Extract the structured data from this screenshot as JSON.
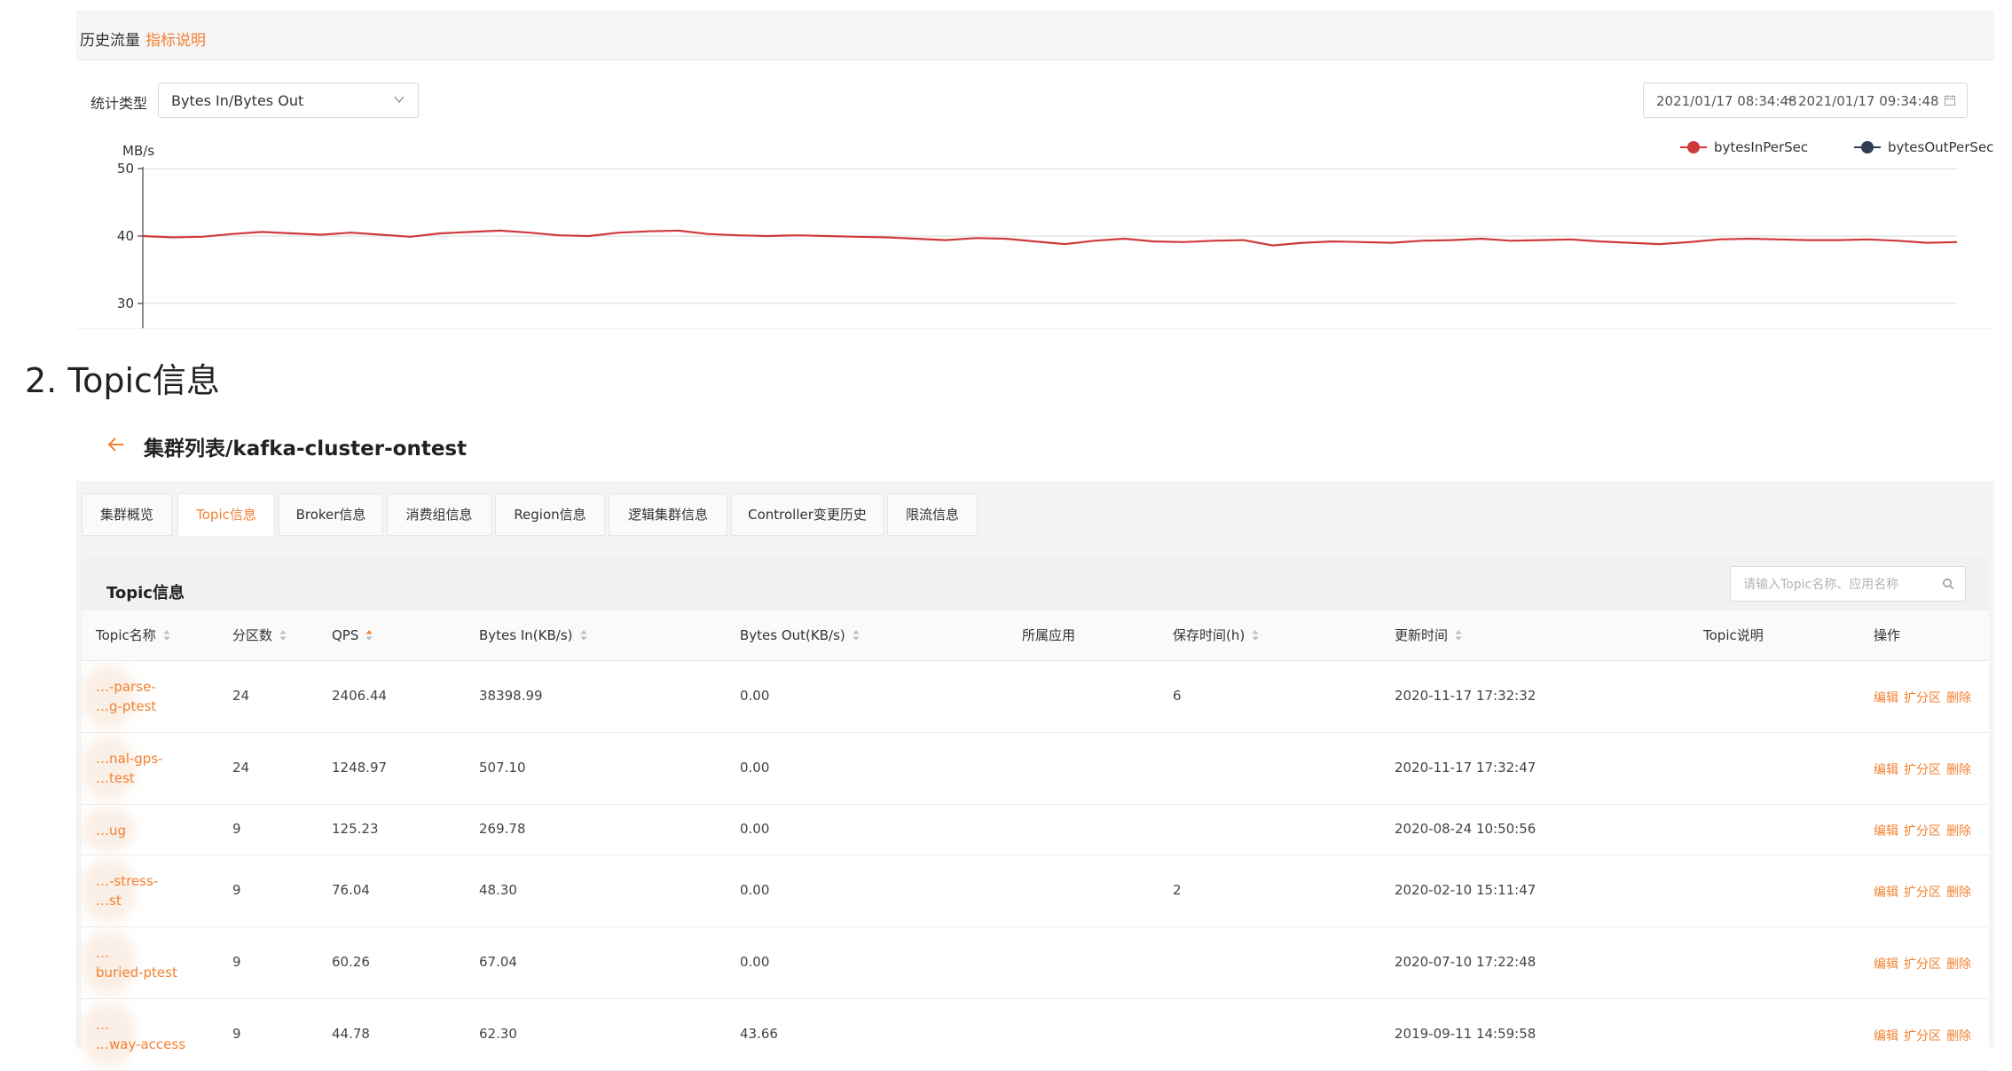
{
  "history": {
    "title": "历史流量",
    "link": "指标说明",
    "stat_label": "统计类型",
    "stat_select_value": "Bytes In/Bytes Out",
    "date_start": "2021/01/17 08:34:48",
    "date_sep": "~",
    "date_end": "2021/01/17 09:34:48"
  },
  "chart_data": {
    "type": "line",
    "ylabel": "MB/s",
    "yticks": [
      50,
      40,
      30
    ],
    "ylim": [
      28,
      52
    ],
    "grid": true,
    "legend_position": "top-right",
    "series": [
      {
        "name": "bytesInPerSec",
        "color": "#d03a3a",
        "values": [
          40.0,
          39.8,
          39.9,
          40.3,
          40.6,
          40.4,
          40.2,
          40.5,
          40.2,
          39.9,
          40.4,
          40.6,
          40.8,
          40.5,
          40.1,
          40.0,
          40.5,
          40.7,
          40.8,
          40.3,
          40.1,
          40.0,
          40.1,
          40.0,
          39.9,
          39.8,
          39.6,
          39.4,
          39.7,
          39.6,
          39.2,
          38.8,
          39.3,
          39.6,
          39.2,
          39.1,
          39.3,
          39.4,
          38.6,
          39.0,
          39.2,
          39.1,
          39.0,
          39.3,
          39.4,
          39.6,
          39.3,
          39.4,
          39.5,
          39.2,
          39.0,
          38.8,
          39.1,
          39.5,
          39.6,
          39.5,
          39.4,
          39.4,
          39.5,
          39.3,
          39.0,
          39.1
        ]
      },
      {
        "name": "bytesOutPerSec",
        "color": "#2f3d52",
        "values": []
      }
    ]
  },
  "section_heading": "2.  Topic信息",
  "breadcrumb": "集群列表/kafka-cluster-ontest",
  "tabs": [
    {
      "label": "集群概览",
      "active": false
    },
    {
      "label": "Topic信息",
      "active": true
    },
    {
      "label": "Broker信息",
      "active": false
    },
    {
      "label": "消费组信息",
      "active": false
    },
    {
      "label": "Region信息",
      "active": false
    },
    {
      "label": "逻辑集群信息",
      "active": false
    },
    {
      "label": "Controller变更历史",
      "active": false
    },
    {
      "label": "限流信息",
      "active": false
    }
  ],
  "table": {
    "title": "Topic信息",
    "search_placeholder": "请输入Topic名称、应用名称",
    "columns": [
      "Topic名称",
      "分区数",
      "QPS",
      "Bytes In(KB/s)",
      "Bytes Out(KB/s)",
      "所属应用",
      "保存时间(h)",
      "更新时间",
      "Topic说明",
      "操作"
    ],
    "rows": [
      {
        "name_l1": "…-parse-",
        "name_l2": "…g-ptest",
        "partitions": "24",
        "qps": "2406.44",
        "bytes_in": "38398.99",
        "bytes_out": "0.00",
        "app": "",
        "retention": "6",
        "updated": "2020-11-17 17:32:32",
        "desc": ""
      },
      {
        "name_l1": "…nal-gps-",
        "name_l2": "…test",
        "partitions": "24",
        "qps": "1248.97",
        "bytes_in": "507.10",
        "bytes_out": "0.00",
        "app": "",
        "retention": "",
        "updated": "2020-11-17 17:32:47",
        "desc": ""
      },
      {
        "name_l1": "…ug",
        "name_l2": "",
        "partitions": "9",
        "qps": "125.23",
        "bytes_in": "269.78",
        "bytes_out": "0.00",
        "app": "",
        "retention": "",
        "updated": "2020-08-24 10:50:56",
        "desc": ""
      },
      {
        "name_l1": "…-stress-",
        "name_l2": "…st",
        "partitions": "9",
        "qps": "76.04",
        "bytes_in": "48.30",
        "bytes_out": "0.00",
        "app": "",
        "retention": "2",
        "updated": "2020-02-10 15:11:47",
        "desc": ""
      },
      {
        "name_l1": "…",
        "name_l2": "buried-ptest",
        "partitions": "9",
        "qps": "60.26",
        "bytes_in": "67.04",
        "bytes_out": "0.00",
        "app": "",
        "retention": "",
        "updated": "2020-07-10 17:22:48",
        "desc": ""
      },
      {
        "name_l1": "…",
        "name_l2": "…way-access",
        "partitions": "9",
        "qps": "44.78",
        "bytes_in": "62.30",
        "bytes_out": "43.66",
        "app": "",
        "retention": "",
        "updated": "2019-09-11 14:59:58",
        "desc": ""
      }
    ],
    "ops": {
      "edit": "编辑",
      "expand": "扩分区",
      "delete": "删除"
    }
  },
  "colors": {
    "accent": "#f38031",
    "in_series": "#d03a3a",
    "out_series": "#2f3d52"
  }
}
